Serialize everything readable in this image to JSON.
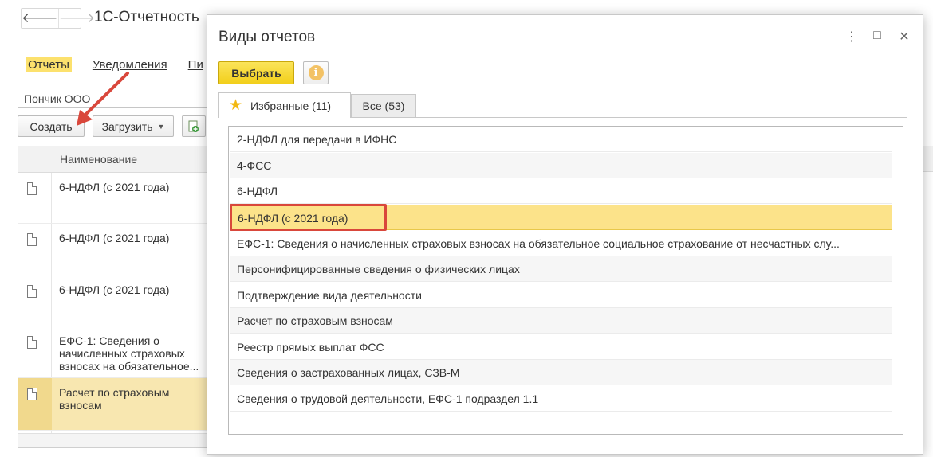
{
  "background": {
    "app_title": "1С-Отчетность",
    "nav": {
      "back_glyph": "🡐",
      "forward_glyph": "🡒"
    },
    "tabs": {
      "active": "Отчеты",
      "notifications": "Уведомления",
      "letters": "Пи"
    },
    "organization": "Пончик ООО",
    "toolbar": {
      "create": "Создать",
      "load": "Загрузить"
    },
    "table": {
      "column_name": "Наименование",
      "rows": [
        "6-НДФЛ (с 2021 года)",
        "6-НДФЛ (с 2021 года)",
        "6-НДФЛ (с 2021 года)",
        "ЕФС-1: Сведения о начисленных страховых взносах на обязательное...",
        "Расчет по страховым взносам"
      ]
    }
  },
  "dialog": {
    "title": "Виды отчетов",
    "select_button": "Выбрать",
    "info_symbol": "i",
    "tabs": {
      "favorites": "Избранные (11)",
      "all": "Все (53)"
    },
    "items": [
      "2-НДФЛ для передачи в ИФНС",
      "4-ФСС",
      "6-НДФЛ",
      "6-НДФЛ (с 2021 года)",
      "ЕФС-1: Сведения о начисленных страховых взносах на обязательное социальное страхование от несчастных слу...",
      "Персонифицированные сведения о физических лицах",
      "Подтверждение вида деятельности",
      "Расчет по страховым взносам",
      "Реестр прямых выплат ФСС",
      "Сведения о застрахованных лицах, СЗВ-М",
      "Сведения о трудовой деятельности, ЕФС-1 подраздел 1.1"
    ],
    "selected_index": 3
  },
  "colors": {
    "accent_yellow": "#f2cf1a",
    "selection": "#fce38a",
    "annotation_red": "#d9473b"
  },
  "icons": [
    "back-arrow-icon",
    "forward-arrow-icon",
    "document-icon",
    "star-icon",
    "info-icon",
    "more-icon",
    "maximize-icon",
    "close-icon",
    "add-doc-icon"
  ]
}
